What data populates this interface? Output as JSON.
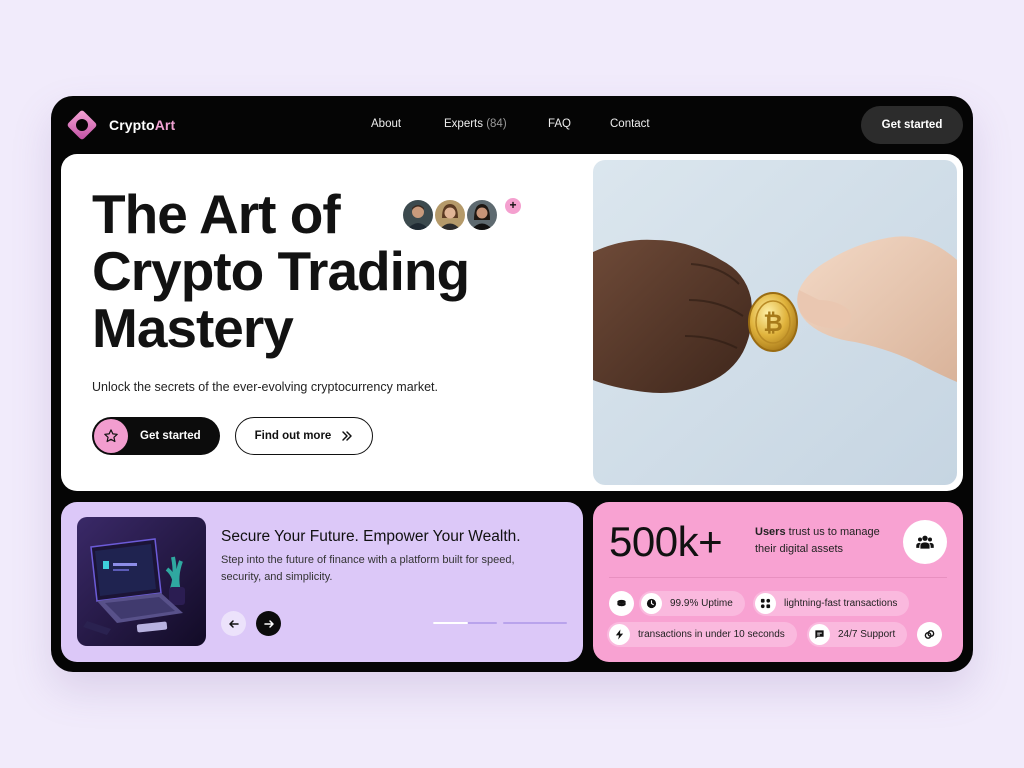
{
  "brand": {
    "name_main": "Crypto",
    "name_accent": "Art",
    "accent_color": "#f2a3d4"
  },
  "nav": {
    "about": "About",
    "experts": "Experts",
    "experts_count": "(84)",
    "faq": "FAQ",
    "contact": "Contact",
    "cta": "Get started"
  },
  "hero": {
    "title_line1": "The Art of",
    "title_line2": "Crypto Trading",
    "title_line3": "Mastery",
    "subtitle": "Unlock the secrets of the ever-evolving cryptocurrency market.",
    "primary_cta": "Get started",
    "secondary_cta": "Find out more",
    "plus_badge": "+"
  },
  "promo": {
    "title": "Secure Your Future. Empower Your Wealth.",
    "description": "Step into the future of finance with a platform built for speed, security, and simplicity.",
    "carousel_progress": [
      0.55,
      0,
      0
    ]
  },
  "stats": {
    "value": "500k+",
    "desc_bold": "Users",
    "desc_rest": " trust us to manage their digital assets",
    "features": [
      {
        "label": "99.9% Uptime",
        "icon": "clock-icon"
      },
      {
        "label": "lightning-fast transactions",
        "icon": "network-icon"
      },
      {
        "label": "transactions in under 10 seconds",
        "icon": "bolt-icon"
      },
      {
        "label": "24/7 Support",
        "icon": "chat-icon"
      }
    ]
  },
  "colors": {
    "frame": "#050505",
    "lavender": "#dcc8f8",
    "pink": "#f8a2d2",
    "pink_accent": "#f29dcf"
  }
}
